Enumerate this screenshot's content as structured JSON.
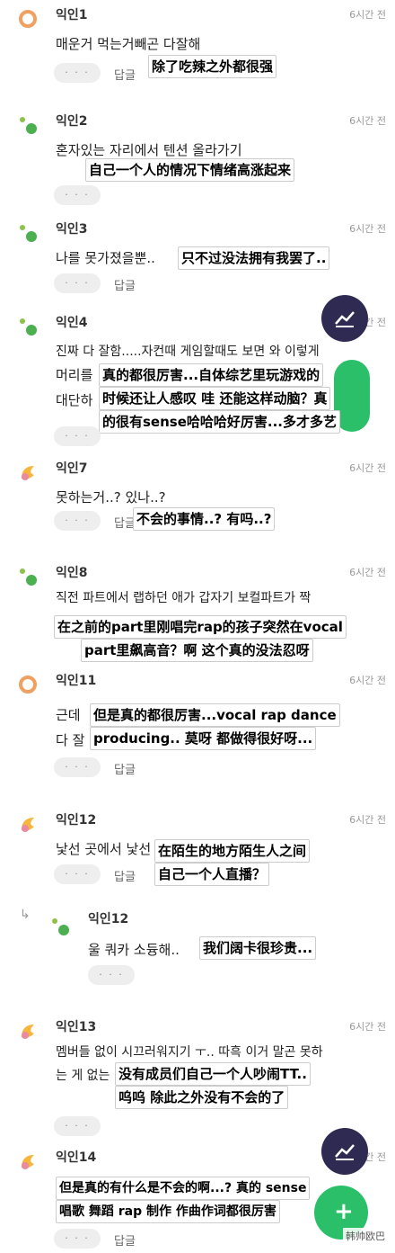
{
  "ui": {
    "more_label": "· · ·",
    "reply_label": "답글",
    "chart_icon": "trending-chart-icon",
    "watermark": "韩帅欧巴"
  },
  "comments": [
    {
      "name": "익인1",
      "time": "6시간 전",
      "korean": "매운거 먹는거빼곤 다잘해",
      "caption": [
        "除了吃辣之外都很强"
      ]
    },
    {
      "name": "익인2",
      "time": "6시간 전",
      "korean": "혼자있는 자리에서 텐션 올라가기",
      "caption": [
        "自己一个人的情况下情绪高涨起来"
      ]
    },
    {
      "name": "익인3",
      "time": "6시간 전",
      "korean": "나를 못가졌을뿐..",
      "caption": [
        "只不过没法拥有我罢了.."
      ]
    },
    {
      "name": "익인4",
      "time": "6시간 전",
      "korean": "진짜 다 잘함.....자컨때 게임할때도 보면 와 이렇게",
      "korean2": "머리를",
      "korean3": "대단하",
      "caption": [
        "真的都很厉害...自体综艺里玩游戏的",
        "时候还让人感叹 哇 还能这样动脑？真",
        "的很有sense哈哈哈好厉害...多才多艺"
      ]
    },
    {
      "name": "익인7",
      "time": "6시간 전",
      "korean": "못하는거..? 있나..?",
      "caption": [
        "不会的事情..? 有吗..?"
      ]
    },
    {
      "name": "익인8",
      "time": "6시간 전",
      "korean": "직전 파트에서 랩하던 애가 갑자기 보컬파트가 짝",
      "caption": [
        "在之前的part里刚唱完rap的孩子突然在vocal",
        "part里飙高音？啊 这个真的没法忍呀"
      ]
    },
    {
      "name": "익인11",
      "time": "6시간 전",
      "korean": "근데",
      "korean2": "다 잘",
      "caption": [
        "但是真的都很厉害...vocal rap dance",
        "producing.. 莫呀 都做得很好呀..."
      ]
    },
    {
      "name": "익인12",
      "time": "6시간 전",
      "korean": "낯선 곳에서 낯선",
      "caption": [
        "在陌生的地方陌生人之间",
        "自己一个人直播？"
      ]
    },
    {
      "name": "익인12",
      "time": "",
      "korean": "울 쿼카 소듕해..",
      "caption": [
        "我们阔卡很珍贵..."
      ]
    },
    {
      "name": "익인13",
      "time": "6시간 전",
      "korean": "멤버들 없이 시끄러워지기 ㅜ.. 따흑 이거 말곤 못하",
      "korean2": "는 게 없는",
      "caption": [
        "没有成员们自己一个人吵闹TT..",
        "呜呜 除此之外没有不会的了"
      ]
    },
    {
      "name": "익인14",
      "time": "6시간 전",
      "korean": "",
      "caption": [
        "但是真的有什么是不会的啊...? 真的 sense",
        "唱歌 舞蹈 rap 制作 作曲作词都很厉害"
      ]
    }
  ]
}
